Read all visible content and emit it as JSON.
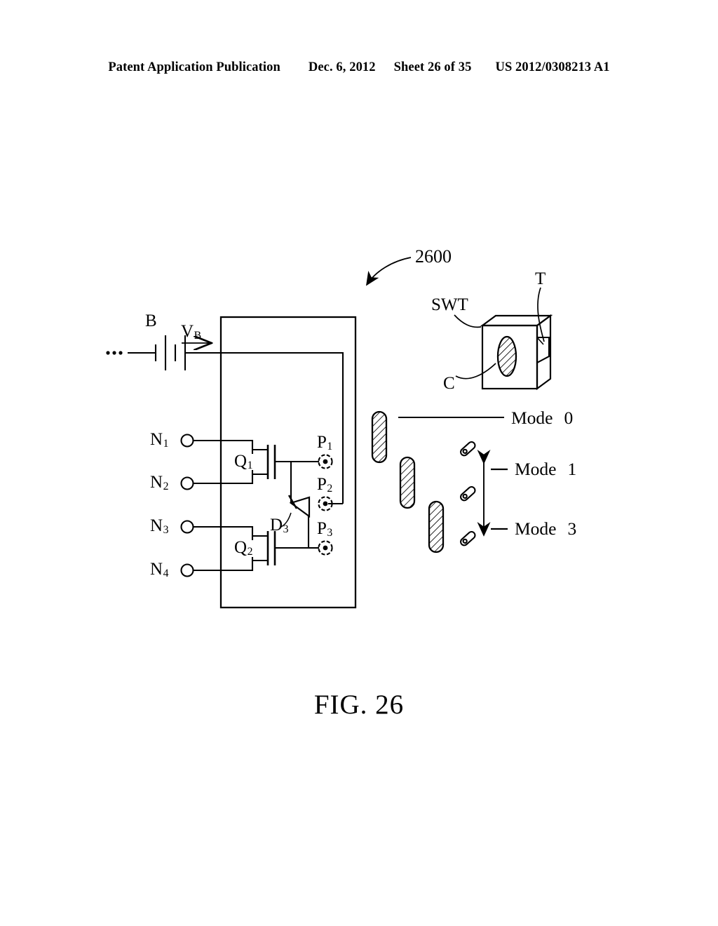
{
  "header": {
    "publication": "Patent Application Publication",
    "date": "Dec. 6, 2012",
    "sheet": "Sheet 26 of 35",
    "patent_number": "US 2012/0308213 A1"
  },
  "figure": {
    "caption": "FIG. 26",
    "reference_numeral": "2600"
  },
  "circuit": {
    "battery_label": "B",
    "battery_voltage_label": "V",
    "battery_voltage_sub": "B",
    "leading_dots": "....",
    "terminals": [
      {
        "label": "N",
        "sub": "1"
      },
      {
        "label": "N",
        "sub": "2"
      },
      {
        "label": "N",
        "sub": "3"
      },
      {
        "label": "N",
        "sub": "4"
      }
    ],
    "transistors": [
      {
        "label": "Q",
        "sub": "1"
      },
      {
        "label": "Q",
        "sub": "2"
      }
    ],
    "diode": {
      "label": "D",
      "sub": "3"
    },
    "ports": [
      {
        "label": "P",
        "sub": "1"
      },
      {
        "label": "P",
        "sub": "2"
      },
      {
        "label": "P",
        "sub": "3"
      }
    ]
  },
  "switch": {
    "body_label": "SWT",
    "contact_label": "C",
    "tab_label": "T"
  },
  "modes": [
    {
      "label": "Mode",
      "num": "0"
    },
    {
      "label": "Mode",
      "num": "1"
    },
    {
      "label": "Mode",
      "num": "3"
    }
  ],
  "colors": {
    "ink": "#000000",
    "paper": "#ffffff"
  }
}
